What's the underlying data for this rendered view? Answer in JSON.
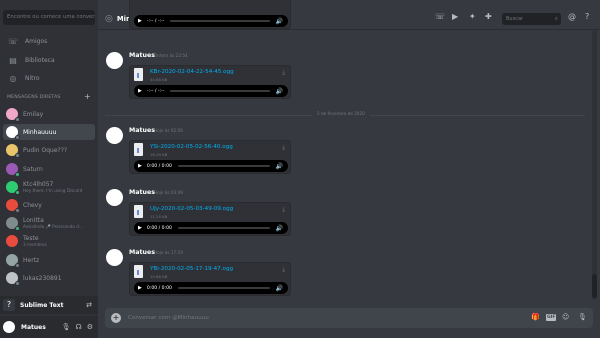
{
  "sidebar": {
    "search_placeholder": "Encontre ou comece uma conversa",
    "nav": [
      {
        "label": "Amigos",
        "icon": "friends-icon"
      },
      {
        "label": "Biblioteca",
        "icon": "library-icon"
      },
      {
        "label": "Nitro",
        "icon": "nitro-icon"
      }
    ],
    "dm_header": "MENSAGENS DIRETAS",
    "dms": [
      {
        "name": "Emilay",
        "sub": "",
        "color": "#f0a8c8",
        "status": "#747f8d"
      },
      {
        "name": "Minhauuuu",
        "sub": "",
        "color": "#ffffff",
        "status": "#747f8d",
        "active": true
      },
      {
        "name": "Pudin Oque???",
        "sub": "",
        "color": "#e9c46a",
        "status": "#747f8d"
      },
      {
        "name": "Saturn",
        "sub": "",
        "color": "#9b59b6",
        "status": "#43b581"
      },
      {
        "name": "Ktc4lh057",
        "sub": "Hey there, I'm using Discord",
        "color": "#2ecc71",
        "status": "#43b581"
      },
      {
        "name": "Chevy",
        "sub": "",
        "color": "#e74c3c",
        "status": "#747f8d"
      },
      {
        "name": "Lonitta",
        "sub": "Assistindo 🎤 Precisando d...",
        "color": "#7f8c8d",
        "status": "#43b581"
      },
      {
        "name": "Teste",
        "sub": "3 membros",
        "color": "#e74c3c",
        "status": ""
      },
      {
        "name": "Hertz",
        "sub": "",
        "color": "#95a5a6",
        "status": "#747f8d"
      },
      {
        "name": "lukas230891",
        "sub": "",
        "color": "#bdc3c7",
        "status": "#747f8d"
      }
    ],
    "activity": {
      "label": "Sublime Text"
    },
    "user": {
      "name": "Matues"
    }
  },
  "header": {
    "title": "Minhauuuu",
    "search_placeholder": "Buscar"
  },
  "messages": [
    {
      "author": "",
      "time": "",
      "file": "",
      "size": "",
      "player_time": "-:-- / -:--"
    },
    {
      "author": "Matues",
      "time": "Ontem às 22:54",
      "file": "KBr-2020-02-04-22-54-45.ogg",
      "size": "44.68 KB",
      "player_time": "-:-- / -:--"
    },
    {
      "author": "Matues",
      "time": "Hoje às 02:56",
      "file": "YSi-2020-02-05-02-56-40.ogg",
      "size": "16.19 KB",
      "player_time": "0:00 / 0:00"
    },
    {
      "author": "Matues",
      "time": "Hoje às 03:49",
      "file": "UJy-2020-02-05-03-49-09.ogg",
      "size": "11.25 KB",
      "player_time": "0:00 / 0:00"
    },
    {
      "author": "Matues",
      "time": "Hoje às 17:19",
      "file": "YBi-2020-02-05-17-19-47.ogg",
      "size": "10.66 KB",
      "player_time": "0:00 / 0:00"
    }
  ],
  "divider": "5 de fevereiro de 2020",
  "composer": {
    "placeholder": "Conversar com @Minhauuuu",
    "gif": "GIF"
  }
}
